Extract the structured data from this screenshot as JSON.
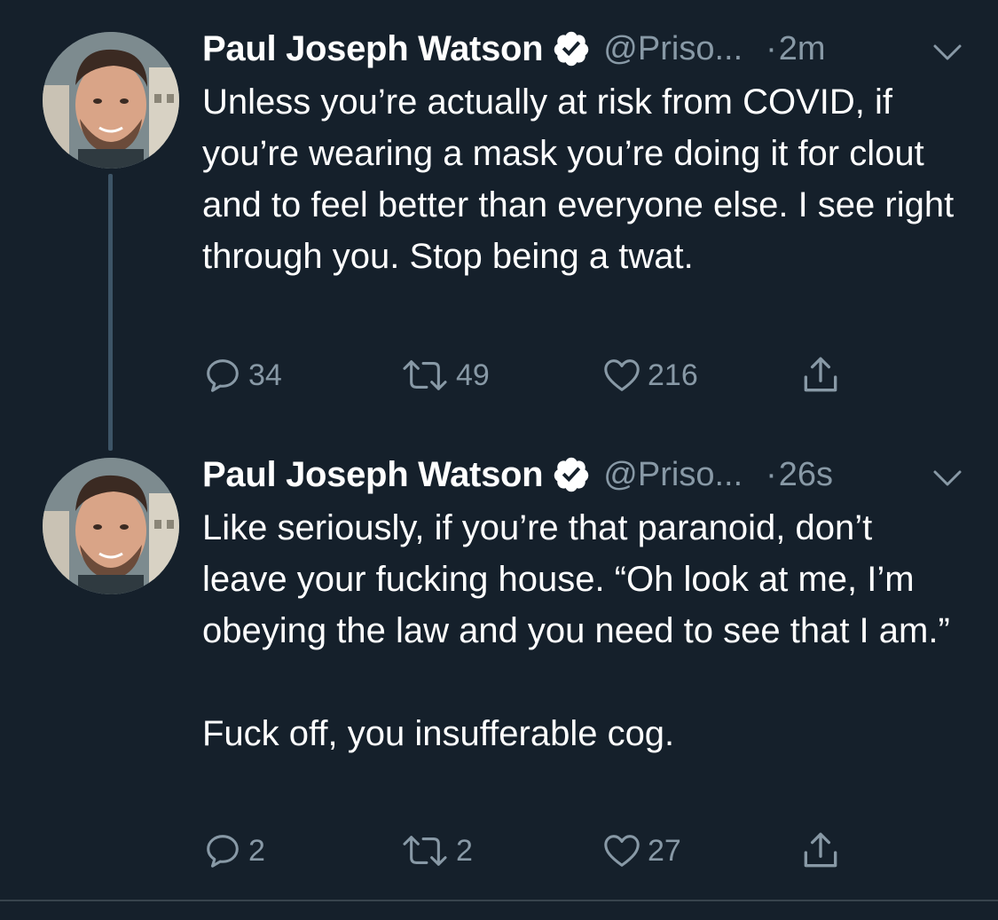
{
  "theme": {
    "background": "#15202b",
    "text": "#ffffff",
    "muted": "#8899a6",
    "thread_line": "#3d5466"
  },
  "tweets": [
    {
      "author": "Paul Joseph Watson",
      "verified_icon": "verified-badge-icon",
      "handle": "@Priso...",
      "dot": "·",
      "time": "2m",
      "text": [
        "Unless you’re actually at risk from COVID, if you’re wearing a mask you’re doing it for clout and to feel better than everyone else. I see right through you. Stop being a twat."
      ],
      "replies": "34",
      "retweets": "49",
      "likes": "216"
    },
    {
      "author": "Paul Joseph Watson",
      "verified_icon": "verified-badge-icon",
      "handle": "@Priso...",
      "dot": "·",
      "time": "26s",
      "text": [
        "Like seriously, if you’re that paranoid, don’t leave your fucking house. “Oh look at me, I’m obeying the law and you need to see that I am.”",
        "Fuck off, you insufferable cog."
      ],
      "replies": "2",
      "retweets": "2",
      "likes": "27"
    }
  ]
}
